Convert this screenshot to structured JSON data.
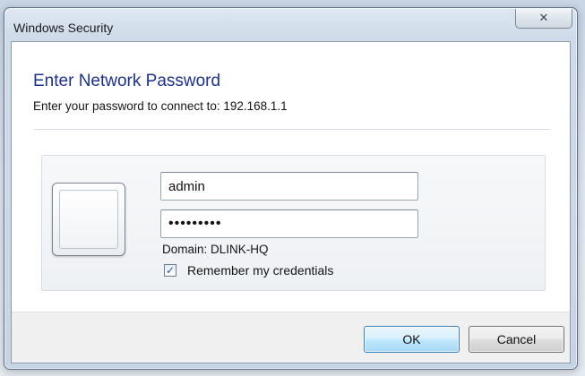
{
  "window": {
    "title": "Windows Security",
    "close_glyph": "✕"
  },
  "dialog": {
    "heading": "Enter Network Password",
    "subheading": "Enter your password to connect to: 192.168.1.1"
  },
  "credentials": {
    "username_value": "admin",
    "password_value": "adminpass",
    "domain_text": "Domain: DLINK-HQ",
    "remember_label": "Remember my credentials",
    "remember_checked": true,
    "check_glyph": "✓"
  },
  "buttons": {
    "ok_label": "OK",
    "cancel_label": "Cancel"
  },
  "colors": {
    "heading": "#1e3287",
    "ok_border": "#3c7fb1"
  }
}
